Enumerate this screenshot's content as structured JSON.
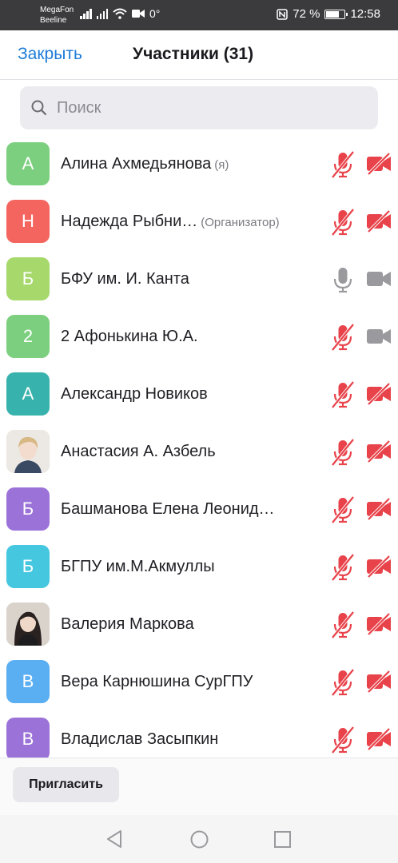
{
  "status": {
    "carrier1": "MegaFon",
    "carrier2": "Beeline",
    "extra": "0°",
    "battery": "72 %",
    "battery_level": 0.72,
    "time": "12:58"
  },
  "header": {
    "close_label": "Закрыть",
    "title": "Участники (31)"
  },
  "search": {
    "placeholder": "Поиск"
  },
  "colors": {
    "accent": "#1d7bd7",
    "muted_red": "#e8434a",
    "icon_gray": "#9a9a9e"
  },
  "participants": [
    {
      "name": "Алина Ахмедьянова",
      "tag": "(я)",
      "initial": "А",
      "color": "#7ccf7e",
      "mic_muted": true,
      "video_off": true
    },
    {
      "name": "Надежда Рыбни…",
      "tag": "(Организатор)",
      "initial": "Н",
      "color": "#f56560",
      "mic_muted": true,
      "video_off": true
    },
    {
      "name": "БФУ им. И. Канта",
      "tag": "",
      "initial": "Б",
      "color": "#a6d86b",
      "mic_muted": false,
      "video_off": false
    },
    {
      "name": "2 Афонькина Ю.А.",
      "tag": "",
      "initial": "2",
      "color": "#7ccf7e",
      "mic_muted": true,
      "video_off": false
    },
    {
      "name": "Александр Новиков",
      "tag": "",
      "initial": "А",
      "color": "#38b2ac",
      "mic_muted": true,
      "video_off": true
    },
    {
      "name": "Анастасия А. Азбель",
      "tag": "",
      "initial": "",
      "photo": "light",
      "color": "#e9e6e2",
      "mic_muted": true,
      "video_off": true
    },
    {
      "name": "Башманова Елена Леонид…",
      "tag": "",
      "initial": "Б",
      "color": "#9b72d8",
      "mic_muted": true,
      "video_off": true
    },
    {
      "name": "БГПУ им.М.Акмуллы",
      "tag": "",
      "initial": "Б",
      "color": "#45c7e0",
      "mic_muted": true,
      "video_off": true
    },
    {
      "name": "Валерия Маркова",
      "tag": "",
      "initial": "",
      "photo": "dark",
      "color": "#d8d2cc",
      "mic_muted": true,
      "video_off": true
    },
    {
      "name": "Вера Карнюшина СурГПУ",
      "tag": "",
      "initial": "В",
      "color": "#5aaef2",
      "mic_muted": true,
      "video_off": true
    },
    {
      "name": "Владислав Засыпкин",
      "tag": "",
      "initial": "В",
      "color": "#9b72d8",
      "mic_muted": true,
      "video_off": true
    }
  ],
  "footer": {
    "invite_label": "Пригласить"
  }
}
